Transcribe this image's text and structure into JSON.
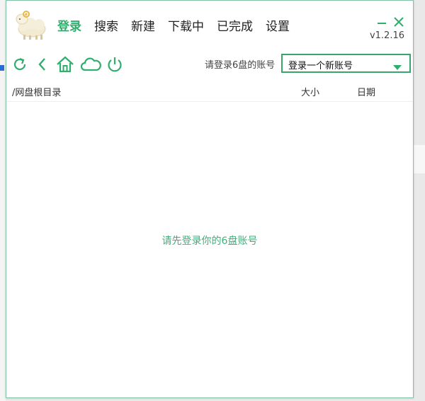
{
  "app": {
    "menu": [
      {
        "label": "登录",
        "active": true
      },
      {
        "label": "搜索",
        "active": false
      },
      {
        "label": "新建",
        "active": false
      },
      {
        "label": "下载中",
        "active": false
      },
      {
        "label": "已完成",
        "active": false
      },
      {
        "label": "设置",
        "active": false
      }
    ],
    "version": "v1.2.16",
    "window_controls": {
      "minimize_icon": "minimize-icon",
      "close_icon": "close-icon"
    }
  },
  "toolbar": {
    "icons": [
      "refresh-icon",
      "back-icon",
      "home-icon",
      "cloud-icon",
      "power-icon"
    ],
    "account_label": "请登录6盘的账号",
    "account_select_value": "登录一个新账号"
  },
  "file_list": {
    "columns": {
      "path": "/网盘根目录",
      "size": "大小",
      "date": "日期"
    },
    "empty_message": "请先登录你的6盘账号"
  },
  "colors": {
    "accent": "#2fae6e",
    "border": "#7fc2a4",
    "empty_text": "#3fae7a"
  }
}
